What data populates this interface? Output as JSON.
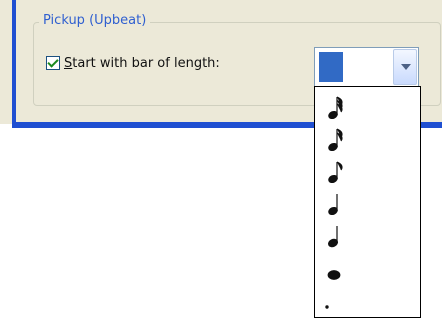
{
  "pickup": {
    "group_title": "Pickup (Upbeat)",
    "checkbox": {
      "checked": true,
      "label_accelerator": "S",
      "label_rest": "tart with bar of length:"
    },
    "selector": {
      "selected_icon": "blank-selected-icon",
      "dropdown_open": true,
      "options": [
        {
          "icon": "thirty-second-note-icon"
        },
        {
          "icon": "sixteenth-note-icon"
        },
        {
          "icon": "eighth-note-icon"
        },
        {
          "icon": "quarter-note-icon"
        },
        {
          "icon": "half-note-icon"
        },
        {
          "icon": "whole-note-icon"
        },
        {
          "icon": "small-dot-icon"
        }
      ]
    }
  },
  "colors": {
    "dialog_bg": "#ece9d8",
    "title_blue": "#2f5fd0",
    "edge_blue": "#1f4fd1",
    "selection_blue": "#316ac5",
    "check_green": "#1d8a1d"
  }
}
